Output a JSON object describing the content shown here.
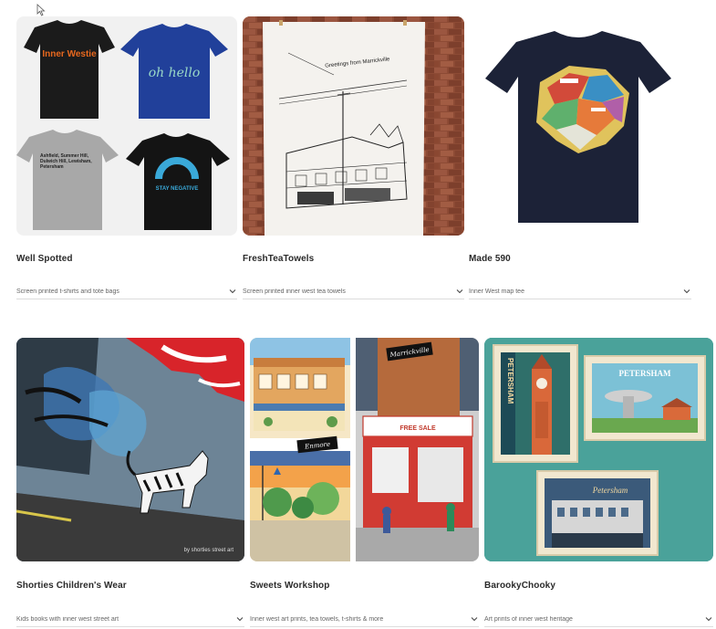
{
  "products": [
    {
      "title": "Well Spotted",
      "description": "Screen printed t-shirts and tote bags",
      "tees": [
        "Inner Westie",
        "oh hello",
        "Ashfield, Summer Hill, Dulwich Hill, Lewisham, Petersham",
        "STAY NEGATIVE"
      ]
    },
    {
      "title": "FreshTeaTowels",
      "description": "Screen printed inner west tea towels",
      "towel_text": "Greetings from Marrickville"
    },
    {
      "title": "Made 590",
      "description": "Inner West map tee"
    },
    {
      "title": "Shorties Children's Wear",
      "description": "Kids books with inner west street art",
      "watermark": "by shorties street art"
    },
    {
      "title": "Sweets Workshop",
      "description": "Inner west art prints, tea towels, t-shirts & more",
      "sign1": "Marrickville",
      "sign2": "Enmore",
      "shopfront": "FREE SALE"
    },
    {
      "title": "BarookyChooky",
      "description": "Art prints of inner west heritage",
      "poster1": "PETERSHAM",
      "poster2": "PETERSHAM",
      "poster3": "Petersham"
    }
  ],
  "colors": {
    "text": "#2a2a2a",
    "muted": "#666666",
    "divider": "#dcdcdc"
  }
}
